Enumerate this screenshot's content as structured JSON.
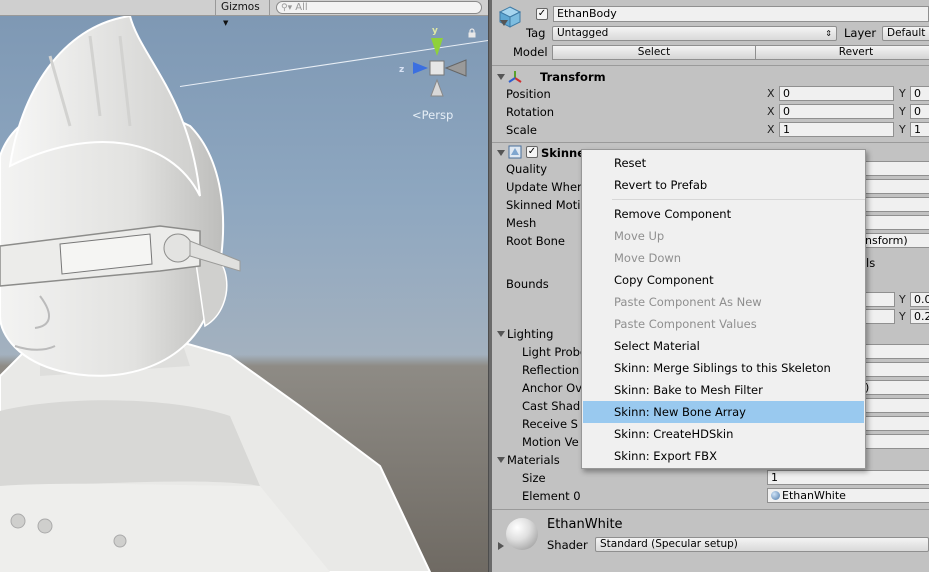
{
  "scene": {
    "gizmos_label": "Gizmos",
    "search_placeholder": "All",
    "persp_label": "Persp",
    "gizmo_axes": {
      "y": "y",
      "z": "z"
    }
  },
  "inspector": {
    "object_name": "EthanBody",
    "tag_label": "Tag",
    "tag_value": "Untagged",
    "layer_label": "Layer",
    "layer_value": "Default",
    "model_label": "Model",
    "select_label": "Select",
    "revert_label": "Revert",
    "transform": {
      "title": "Transform",
      "rows": [
        {
          "label": "Position",
          "x": "0",
          "y": "0"
        },
        {
          "label": "Rotation",
          "x": "0",
          "y": "0"
        },
        {
          "label": "Scale",
          "x": "1",
          "y": "1"
        }
      ]
    },
    "skinned": {
      "title": "Skinned Mesh Renderer",
      "quality": "Quality",
      "update_when": "Update When",
      "skinned_motion": "Skinned Motio",
      "mesh": "Mesh",
      "root_bone": "Root Bone",
      "root_bone_value": "nsform)",
      "bounds": "Bounds",
      "bounds_partial": "ls",
      "bounds_y1": "0.0",
      "bounds_y2": "0.2"
    },
    "lighting": {
      "title": "Lighting",
      "light_probes": "Light Probe",
      "reflection": "Reflection",
      "anchor": "Anchor Ov",
      "cast": "Cast Shad",
      "receive": "Receive S",
      "motion": "Motion Ve",
      "anchor_value": ")"
    },
    "materials": {
      "title": "Materials",
      "size_label": "Size",
      "size_value": "1",
      "element_label": "Element 0",
      "element_value": "EthanWhite"
    },
    "material_panel": {
      "name": "EthanWhite",
      "shader_label": "Shader",
      "shader_value": "Standard (Specular setup)"
    },
    "axis": {
      "x": "X",
      "y": "Y"
    }
  },
  "context_menu": {
    "items": [
      {
        "label": "Reset",
        "enabled": true
      },
      {
        "label": "Revert to Prefab",
        "enabled": true
      },
      {
        "label": "Remove Component",
        "enabled": true
      },
      {
        "label": "Move Up",
        "enabled": false
      },
      {
        "label": "Move Down",
        "enabled": false
      },
      {
        "label": "Copy Component",
        "enabled": true
      },
      {
        "label": "Paste Component As New",
        "enabled": false
      },
      {
        "label": "Paste Component Values",
        "enabled": false
      },
      {
        "label": "Select Material",
        "enabled": true
      },
      {
        "label": "Skinn: Merge Siblings to this Skeleton",
        "enabled": true
      },
      {
        "label": "Skinn: Bake to Mesh Filter",
        "enabled": true
      },
      {
        "label": "Skinn: New Bone Array",
        "enabled": true,
        "highlighted": true
      },
      {
        "label": "Skinn: CreateHDSkin",
        "enabled": true
      },
      {
        "label": "Skinn: Export FBX",
        "enabled": true
      }
    ]
  },
  "colors": {
    "highlight": "#99c9ef",
    "gizmo_y": "#8fd13a",
    "gizmo_z": "#3b6fe0",
    "inspector_bg": "#c2c2c2"
  }
}
